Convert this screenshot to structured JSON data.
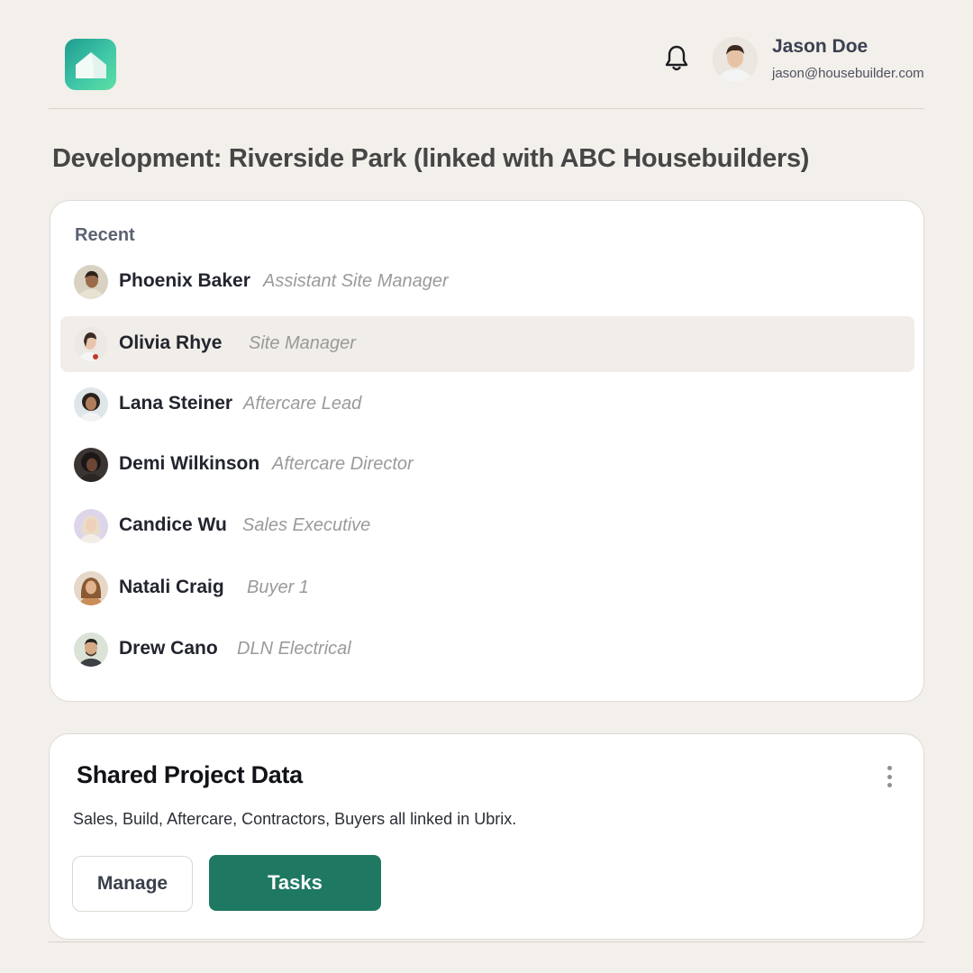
{
  "header": {
    "logo_icon": "house-icon",
    "notification_icon": "bell-icon",
    "user": {
      "name": "Jason Doe",
      "email": "jason@housebuilder.com"
    }
  },
  "page_title": "Development: Riverside Park (linked with ABC Housebuilders)",
  "recent": {
    "heading": "Recent",
    "selected_index": 1,
    "people": [
      {
        "name": "Phoenix Baker",
        "role": "Assistant Site Manager"
      },
      {
        "name": "Olivia Rhye",
        "role": "Site Manager"
      },
      {
        "name": "Lana Steiner",
        "role": "Aftercare Lead"
      },
      {
        "name": "Demi Wilkinson",
        "role": "Aftercare Director"
      },
      {
        "name": "Candice Wu",
        "role": "Sales Executive"
      },
      {
        "name": "Natali Craig",
        "role": "Buyer 1"
      },
      {
        "name": "Drew Cano",
        "role": "DLN Electrical"
      }
    ]
  },
  "shared": {
    "title": "Shared Project Data",
    "description": "Sales, Build, Aftercare, Contractors, Buyers all linked in Ubrix.",
    "menu_icon": "more-vertical-icon",
    "manage_label": "Manage",
    "tasks_label": "Tasks"
  },
  "colors": {
    "background": "#f3efea",
    "accent": "#1f7862",
    "selected_row": "#f1ede8"
  }
}
